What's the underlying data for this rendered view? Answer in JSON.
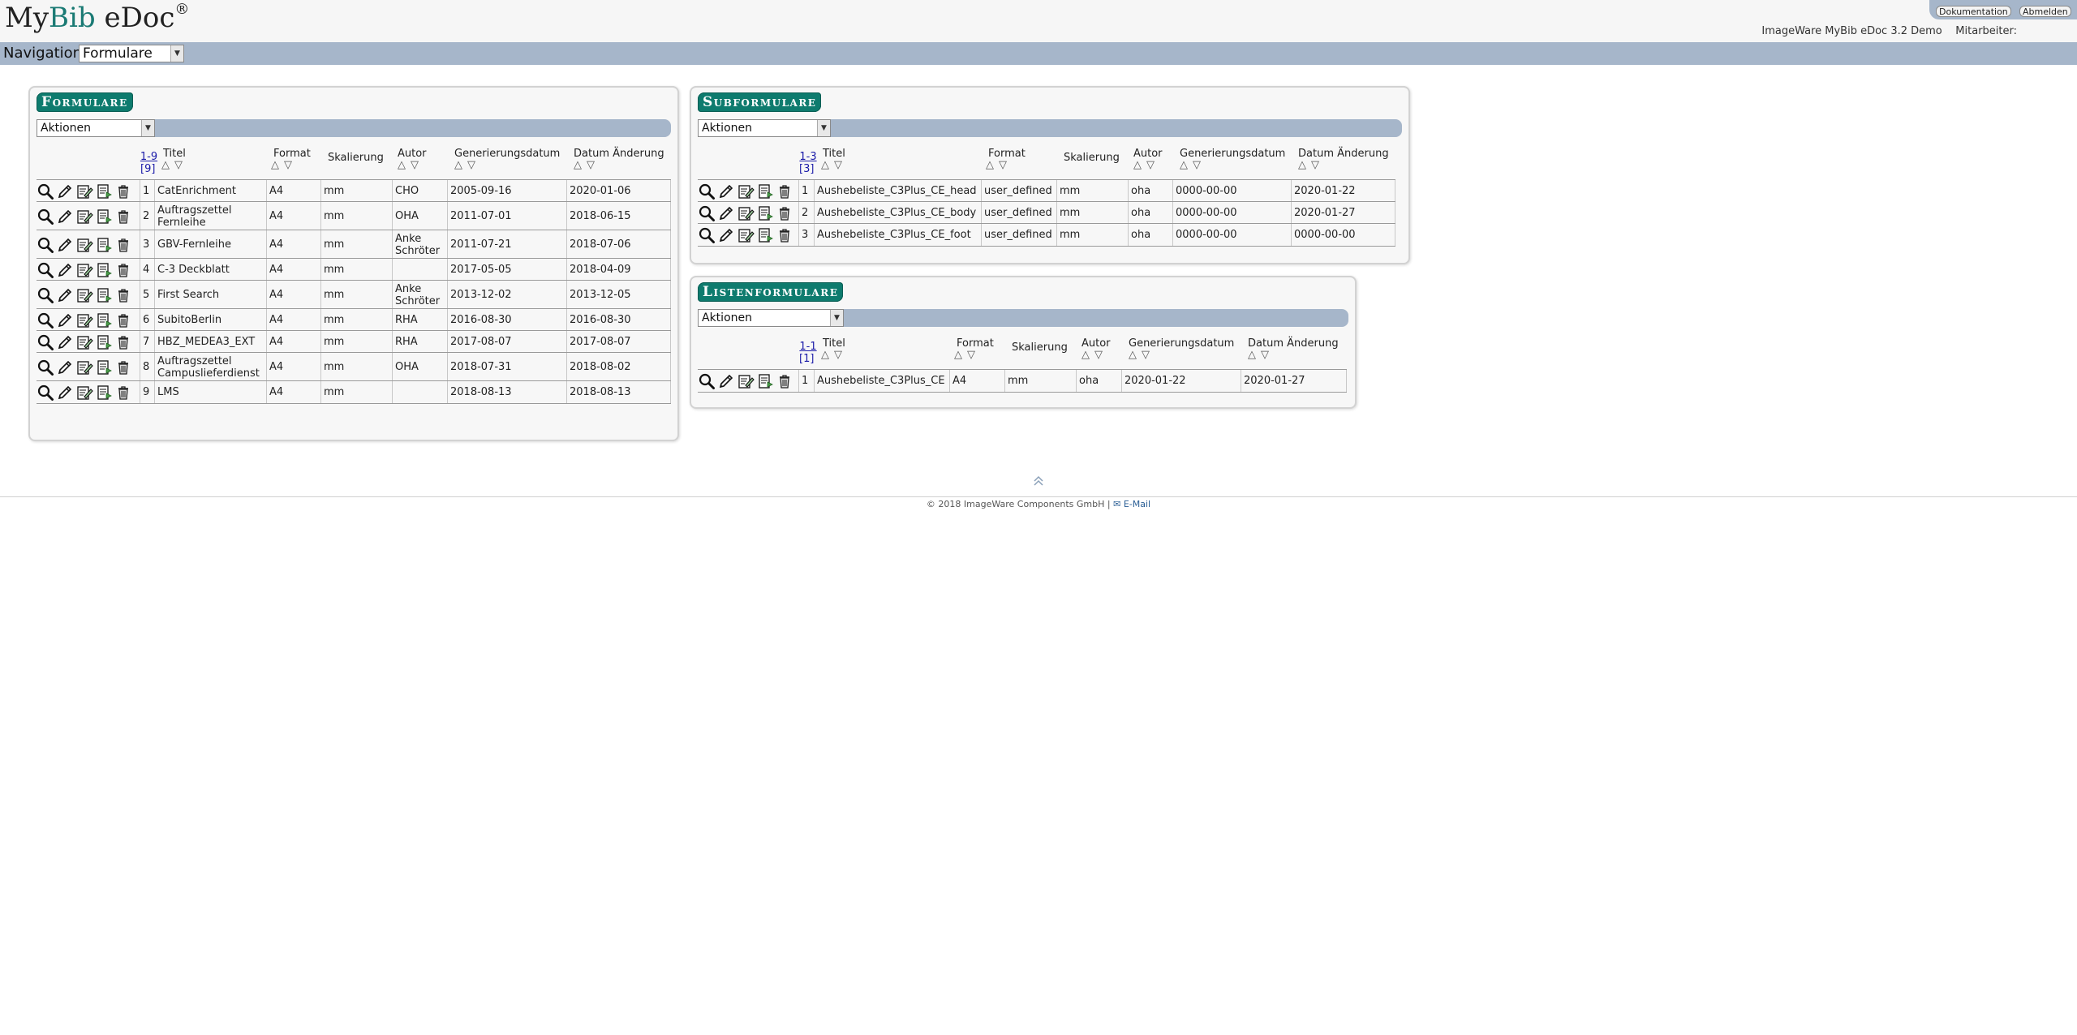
{
  "app": {
    "logo_prefix": "My",
    "logo_accent": "Bib",
    "logo_suffix": " eDoc",
    "logo_mark": "®",
    "version": "ImageWare MyBib eDoc 3.2 Demo",
    "staff_label": "Mitarbeiter:",
    "buttons": {
      "documentation": "Dokumentation",
      "logout": "Abmelden"
    }
  },
  "nav": {
    "label": "Navigation:",
    "selected": "Formulare"
  },
  "formulare": {
    "title": "Formulare",
    "actions": "Aktionen",
    "range": "1-9",
    "total": "[9]",
    "columns": [
      "Titel",
      "Format",
      "Skalierung",
      "Autor",
      "Generierungsdatum",
      "Datum Änderung"
    ],
    "rows": [
      {
        "n": "1",
        "title": "CatEnrichment",
        "format": "A4",
        "scale": "mm",
        "author": "CHO",
        "gen": "2005-09-16",
        "changed": "2020-01-06"
      },
      {
        "n": "2",
        "title": "Auftragszettel Fernleihe",
        "format": "A4",
        "scale": "mm",
        "author": "OHA",
        "gen": "2011-07-01",
        "changed": "2018-06-15"
      },
      {
        "n": "3",
        "title": "GBV-Fernleihe",
        "format": "A4",
        "scale": "mm",
        "author": "Anke Schröter",
        "gen": "2011-07-21",
        "changed": "2018-07-06"
      },
      {
        "n": "4",
        "title": "C-3 Deckblatt",
        "format": "A4",
        "scale": "mm",
        "author": "",
        "gen": "2017-05-05",
        "changed": "2018-04-09"
      },
      {
        "n": "5",
        "title": "First Search",
        "format": "A4",
        "scale": "mm",
        "author": "Anke Schröter",
        "gen": "2013-12-02",
        "changed": "2013-12-05"
      },
      {
        "n": "6",
        "title": "SubitoBerlin",
        "format": "A4",
        "scale": "mm",
        "author": "RHA",
        "gen": "2016-08-30",
        "changed": "2016-08-30"
      },
      {
        "n": "7",
        "title": "HBZ_MEDEA3_EXT",
        "format": "A4",
        "scale": "mm",
        "author": "RHA",
        "gen": "2017-08-07",
        "changed": "2017-08-07"
      },
      {
        "n": "8",
        "title": "Auftragszettel Campuslieferdienst",
        "format": "A4",
        "scale": "mm",
        "author": "OHA",
        "gen": "2018-07-31",
        "changed": "2018-08-02"
      },
      {
        "n": "9",
        "title": "LMS",
        "format": "A4",
        "scale": "mm",
        "author": "",
        "gen": "2018-08-13",
        "changed": "2018-08-13"
      }
    ]
  },
  "subformulare": {
    "title": "Subformulare",
    "actions": "Aktionen",
    "range": "1-3",
    "total": "[3]",
    "columns": [
      "Titel",
      "Format",
      "Skalierung",
      "Autor",
      "Generierungsdatum",
      "Datum Änderung"
    ],
    "rows": [
      {
        "n": "1",
        "title": "Aushebeliste_C3Plus_CE_head",
        "format": "user_defined",
        "scale": "mm",
        "author": "oha",
        "gen": "0000-00-00",
        "changed": "2020-01-22"
      },
      {
        "n": "2",
        "title": "Aushebeliste_C3Plus_CE_body",
        "format": "user_defined",
        "scale": "mm",
        "author": "oha",
        "gen": "0000-00-00",
        "changed": "2020-01-27"
      },
      {
        "n": "3",
        "title": "Aushebeliste_C3Plus_CE_foot",
        "format": "user_defined",
        "scale": "mm",
        "author": "oha",
        "gen": "0000-00-00",
        "changed": "0000-00-00"
      }
    ]
  },
  "listenformulare": {
    "title": "Listenformulare",
    "actions": "Aktionen",
    "range": "1-1",
    "total": "[1]",
    "columns": [
      "Titel",
      "Format",
      "Skalierung",
      "Autor",
      "Generierungsdatum",
      "Datum Änderung"
    ],
    "rows": [
      {
        "n": "1",
        "title": "Aushebeliste_C3Plus_CE",
        "format": "A4",
        "scale": "mm",
        "author": "oha",
        "gen": "2020-01-22",
        "changed": "2020-01-27"
      }
    ]
  },
  "footer": {
    "copyright": "© 2018 ImageWare Components GmbH |",
    "email": "E-Mail"
  },
  "icons": [
    "search-icon",
    "pencil-icon",
    "edit-form-icon",
    "copy-form-icon",
    "trash-icon",
    "envelope-icon",
    "scroll-top-icon"
  ]
}
